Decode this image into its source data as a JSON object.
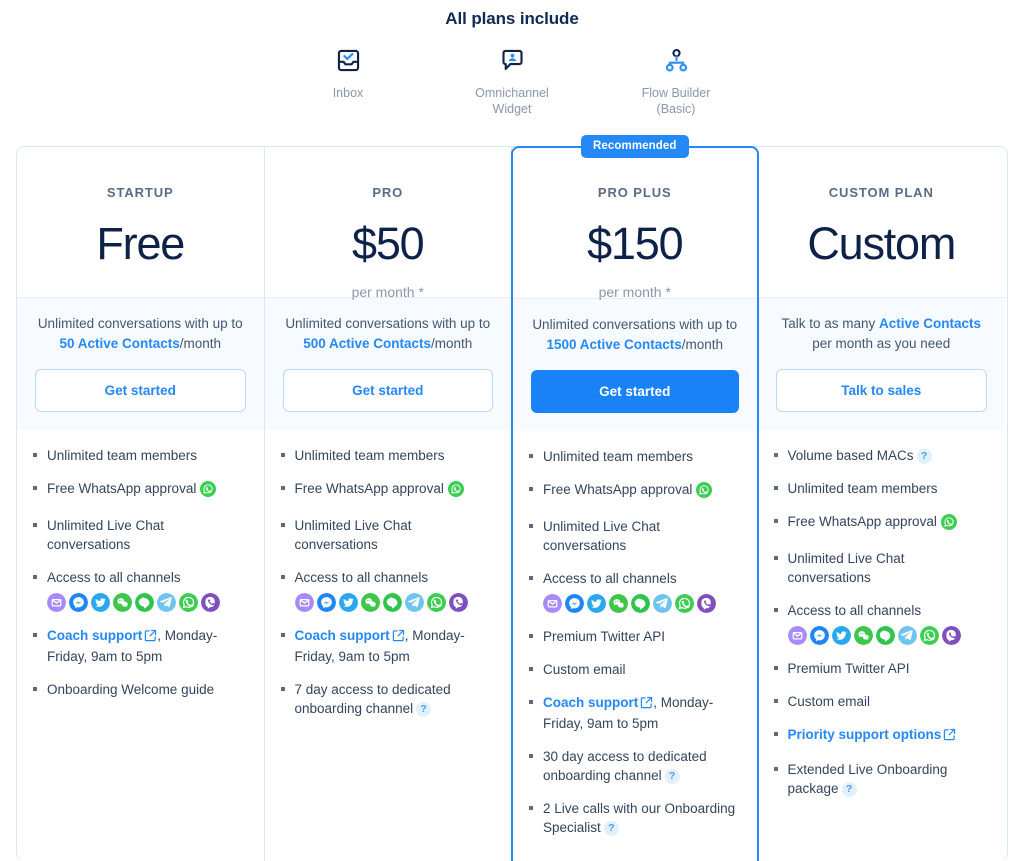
{
  "include": {
    "title": "All plans include",
    "items": [
      {
        "icon": "inbox-icon",
        "label": "Inbox"
      },
      {
        "icon": "omnichannel-widget-icon",
        "label": "Omnichannel Widget"
      },
      {
        "icon": "flow-builder-icon",
        "label": "Flow Builder (Basic)"
      }
    ]
  },
  "colors": {
    "accent": "#2488f7",
    "primary_button": "#1a82f7",
    "heading": "#102a56",
    "price": "#0e2149",
    "muted": "#8b97ab",
    "card_border": "#d7e6fb",
    "featured_border": "#2488f7",
    "sub_background": "#f7fbff",
    "badge_background": "#2488f7",
    "help_badge_background": "#e2effd"
  },
  "channels": [
    {
      "name": "email-channel-icon",
      "color": "#a78bfa"
    },
    {
      "name": "messenger-channel-icon",
      "color": "#1f86f6"
    },
    {
      "name": "twitter-channel-icon",
      "color": "#29a8f0"
    },
    {
      "name": "wechat-channel-icon",
      "color": "#3ec64a"
    },
    {
      "name": "line-channel-icon",
      "color": "#2fc44d"
    },
    {
      "name": "telegram-channel-icon",
      "color": "#6fc4ef"
    },
    {
      "name": "whatsapp-channel-icon",
      "color": "#3ccd52"
    },
    {
      "name": "viber-channel-icon",
      "color": "#7d4fc0"
    }
  ],
  "plans": [
    {
      "id": "startup",
      "name": "STARTUP",
      "price": "Free",
      "period": "",
      "recommended": false,
      "badge": "",
      "sub_prefix": "Unlimited conversations with up to ",
      "sub_highlight": "50 Active Contacts",
      "sub_suffix": "/month",
      "cta": "Get started",
      "cta_style": "outline",
      "features": [
        {
          "type": "text",
          "text": "Unlimited team members"
        },
        {
          "type": "whatsapp",
          "text": "Free WhatsApp approval"
        },
        {
          "type": "text",
          "text": "Unlimited Live Chat conversations"
        },
        {
          "type": "channels",
          "text": "Access to all channels"
        },
        {
          "type": "link",
          "link": "Coach support",
          "text": ", Monday-Friday, 9am to 5pm"
        },
        {
          "type": "text",
          "text": "Onboarding Welcome guide"
        }
      ]
    },
    {
      "id": "pro",
      "name": "PRO",
      "price": "$50",
      "period": "per month *",
      "recommended": false,
      "badge": "",
      "sub_prefix": "Unlimited conversations with up to ",
      "sub_highlight": "500 Active Contacts",
      "sub_suffix": "/month",
      "cta": "Get started",
      "cta_style": "outline",
      "features": [
        {
          "type": "text",
          "text": "Unlimited team members"
        },
        {
          "type": "whatsapp",
          "text": "Free WhatsApp approval"
        },
        {
          "type": "text",
          "text": "Unlimited Live Chat conversations"
        },
        {
          "type": "channels",
          "text": "Access to all channels"
        },
        {
          "type": "link",
          "link": "Coach support",
          "text": ", Monday-Friday, 9am to 5pm"
        },
        {
          "type": "help",
          "text": "7 day access to dedicated onboarding channel"
        }
      ]
    },
    {
      "id": "pro-plus",
      "name": "PRO PLUS",
      "price": "$150",
      "period": "per month *",
      "recommended": true,
      "badge": "Recommended",
      "sub_prefix": "Unlimited conversations with up to ",
      "sub_highlight": "1500 Active Contacts",
      "sub_suffix": "/month",
      "cta": "Get started",
      "cta_style": "primary",
      "features": [
        {
          "type": "text",
          "text": "Unlimited team members"
        },
        {
          "type": "whatsapp",
          "text": "Free WhatsApp approval"
        },
        {
          "type": "text",
          "text": "Unlimited Live Chat conversations"
        },
        {
          "type": "channels",
          "text": "Access to all channels"
        },
        {
          "type": "text",
          "text": "Premium Twitter API"
        },
        {
          "type": "text",
          "text": "Custom email"
        },
        {
          "type": "link",
          "link": "Coach support",
          "text": ", Monday-Friday, 9am to 5pm"
        },
        {
          "type": "help",
          "text": "30 day access to dedicated onboarding channel"
        },
        {
          "type": "help",
          "text": "2 Live calls with our Onboarding Specialist"
        }
      ]
    },
    {
      "id": "custom",
      "name": "CUSTOM PLAN",
      "price": "Custom",
      "period": "",
      "recommended": false,
      "badge": "",
      "sub_prefix": "Talk to as many ",
      "sub_highlight": "Active Contacts",
      "sub_suffix": " per month as you need",
      "cta": "Talk to sales",
      "cta_style": "outline",
      "features": [
        {
          "type": "help",
          "text": "Volume based MACs"
        },
        {
          "type": "text",
          "text": "Unlimited team members"
        },
        {
          "type": "whatsapp",
          "text": "Free WhatsApp approval"
        },
        {
          "type": "text",
          "text": "Unlimited Live Chat conversations"
        },
        {
          "type": "channels",
          "text": "Access to all channels"
        },
        {
          "type": "text",
          "text": "Premium Twitter API"
        },
        {
          "type": "text",
          "text": "Custom email"
        },
        {
          "type": "link",
          "link": "Priority support options",
          "text": ""
        },
        {
          "type": "help",
          "text": "Extended Live Onboarding package"
        }
      ]
    }
  ]
}
